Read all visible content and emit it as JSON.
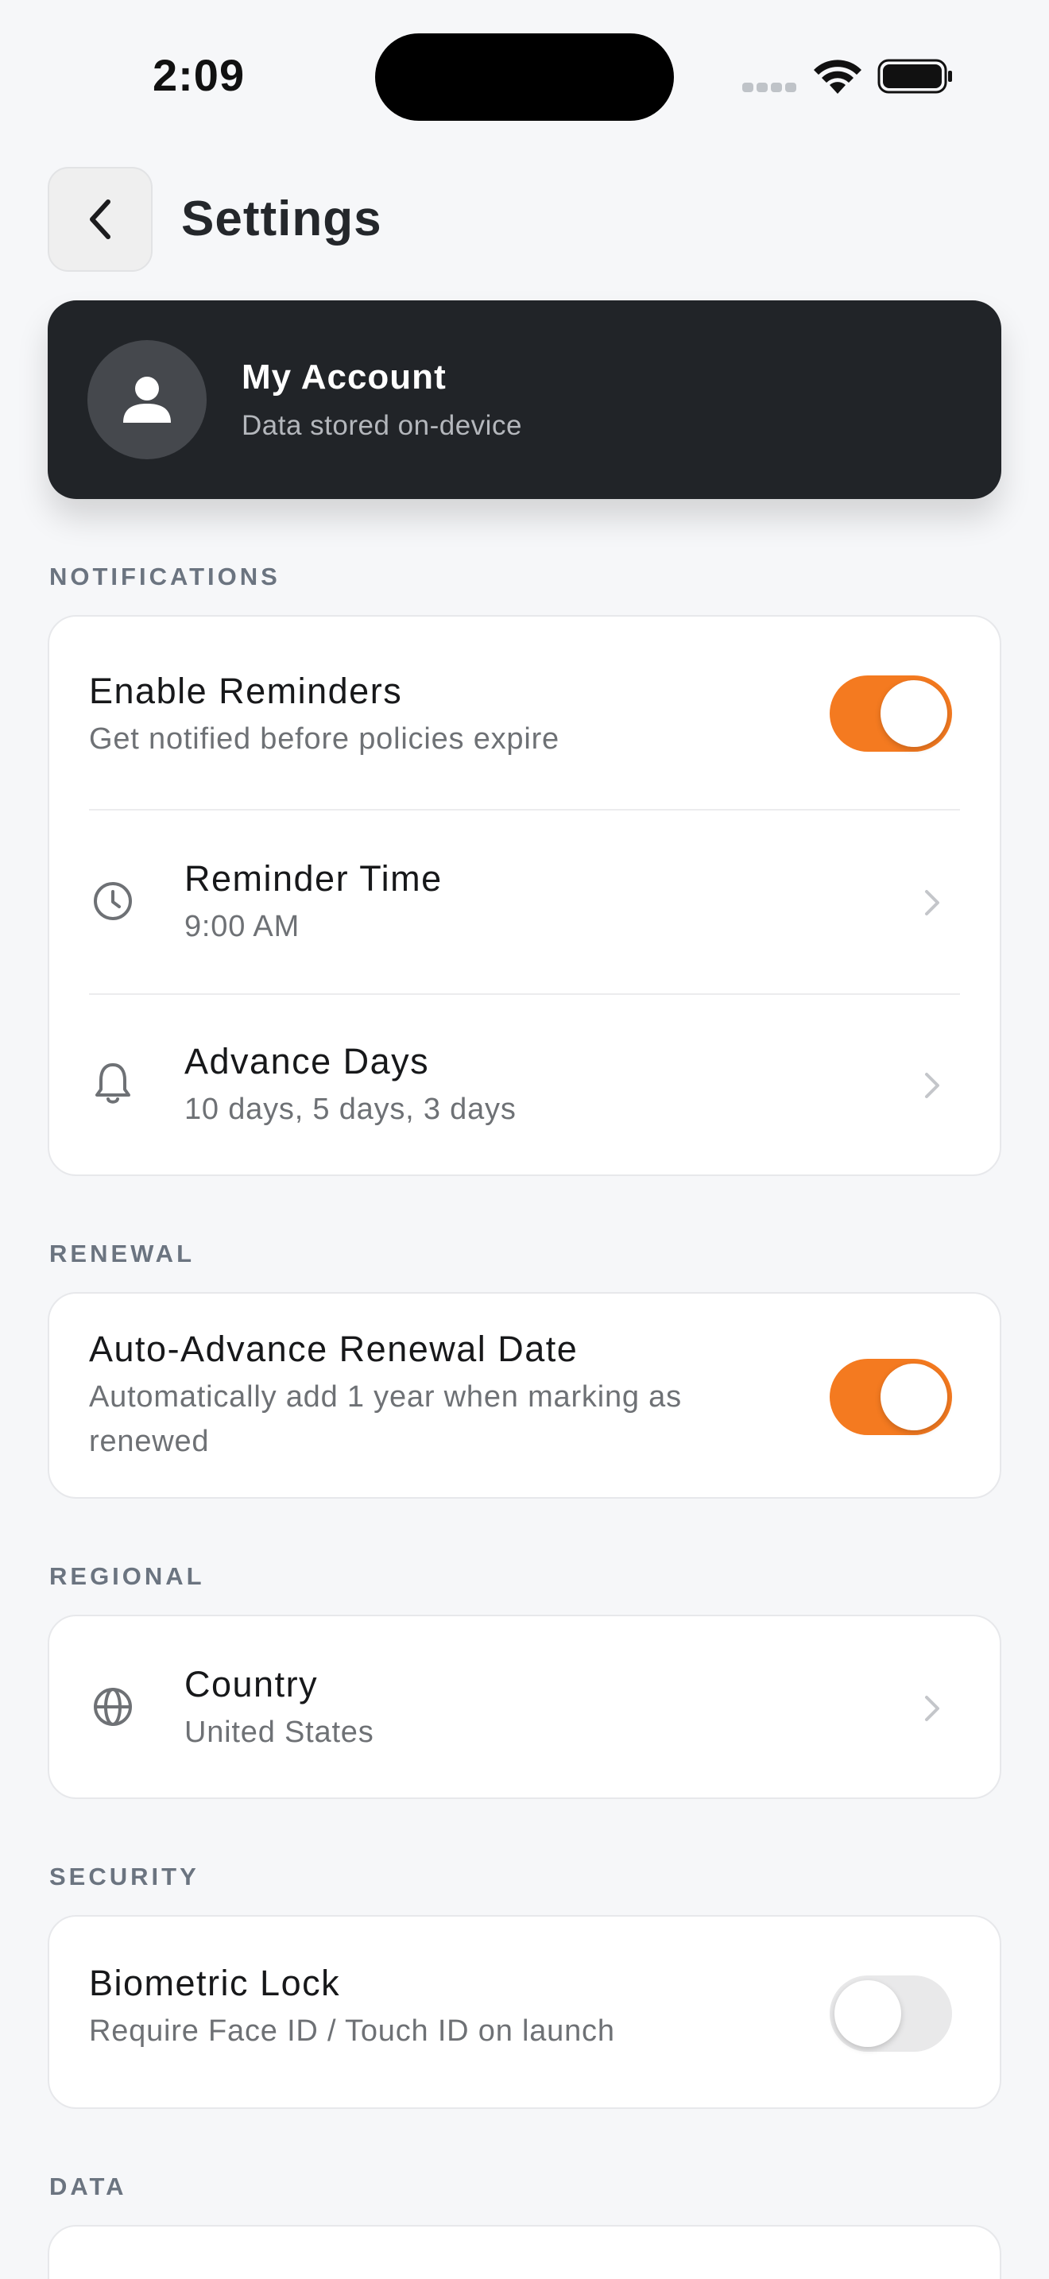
{
  "status_bar": {
    "time": "2:09"
  },
  "header": {
    "title": "Settings"
  },
  "account": {
    "name": "My Account",
    "subtitle": "Data stored on-device"
  },
  "sections": {
    "notifications": {
      "label": "NOTIFICATIONS",
      "enable_reminders": {
        "title": "Enable Reminders",
        "subtitle": "Get notified before policies expire",
        "enabled": true
      },
      "reminder_time": {
        "title": "Reminder Time",
        "value": "9:00 AM",
        "icon": "clock-icon"
      },
      "advance_days": {
        "title": "Advance Days",
        "value": "10 days, 5 days, 3 days",
        "icon": "bell-icon"
      }
    },
    "renewal": {
      "label": "RENEWAL",
      "auto_advance": {
        "title": "Auto-Advance Renewal Date",
        "subtitle_line1": "Automatically add 1 year when marking as",
        "subtitle_line2": "renewed",
        "enabled": true
      }
    },
    "regional": {
      "label": "REGIONAL",
      "country": {
        "title": "Country",
        "value": "United States",
        "icon": "globe-icon"
      }
    },
    "security": {
      "label": "SECURITY",
      "biometric": {
        "title": "Biometric Lock",
        "subtitle": "Require Face ID / Touch ID on launch",
        "enabled": false
      }
    },
    "data": {
      "label": "DATA"
    }
  },
  "colors": {
    "accent": "#f47a20",
    "card_dark": "#212428",
    "background": "#f6f7f9"
  }
}
